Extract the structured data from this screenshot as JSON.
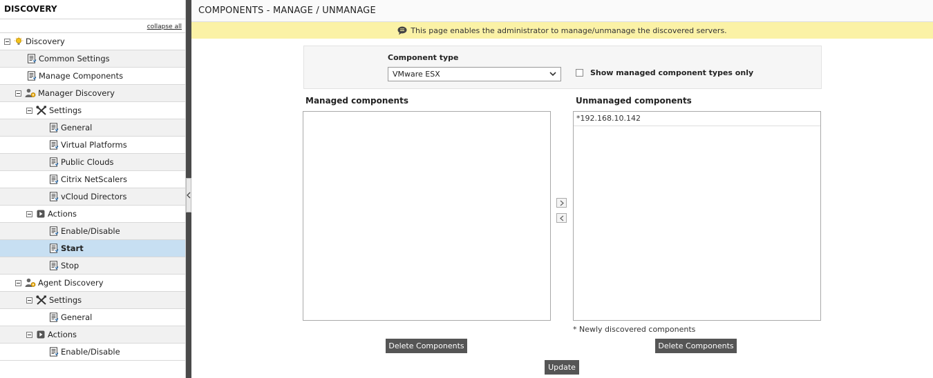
{
  "sidebar": {
    "title": "DISCOVERY",
    "collapse_all": "collapse all",
    "items": [
      {
        "label": "Discovery",
        "depth": 0,
        "toggle": true,
        "icon": "lightbulb-icon",
        "shade": false,
        "selected": false
      },
      {
        "label": "Common Settings",
        "depth": 1,
        "toggle": false,
        "icon": "page-icon",
        "shade": true,
        "selected": false
      },
      {
        "label": "Manage Components",
        "depth": 1,
        "toggle": false,
        "icon": "page-icon",
        "shade": false,
        "selected": false
      },
      {
        "label": "Manager Discovery",
        "depth": 1,
        "toggle": true,
        "icon": "user-gear-icon",
        "shade": true,
        "selected": false
      },
      {
        "label": "Settings",
        "depth": 2,
        "toggle": true,
        "icon": "tools-icon",
        "shade": false,
        "selected": false
      },
      {
        "label": "General",
        "depth": 3,
        "toggle": false,
        "icon": "page-icon",
        "shade": true,
        "selected": false
      },
      {
        "label": "Virtual Platforms",
        "depth": 3,
        "toggle": false,
        "icon": "page-icon",
        "shade": false,
        "selected": false
      },
      {
        "label": "Public Clouds",
        "depth": 3,
        "toggle": false,
        "icon": "page-icon",
        "shade": true,
        "selected": false
      },
      {
        "label": "Citrix NetScalers",
        "depth": 3,
        "toggle": false,
        "icon": "page-icon",
        "shade": false,
        "selected": false
      },
      {
        "label": "vCloud Directors",
        "depth": 3,
        "toggle": false,
        "icon": "page-icon",
        "shade": true,
        "selected": false
      },
      {
        "label": "Actions",
        "depth": 2,
        "toggle": true,
        "icon": "play-icon",
        "shade": false,
        "selected": false
      },
      {
        "label": "Enable/Disable",
        "depth": 3,
        "toggle": false,
        "icon": "page-icon",
        "shade": true,
        "selected": false
      },
      {
        "label": "Start",
        "depth": 3,
        "toggle": false,
        "icon": "page-icon",
        "shade": false,
        "selected": true
      },
      {
        "label": "Stop",
        "depth": 3,
        "toggle": false,
        "icon": "page-icon",
        "shade": true,
        "selected": false
      },
      {
        "label": "Agent Discovery",
        "depth": 1,
        "toggle": true,
        "icon": "user-gear-icon",
        "shade": false,
        "selected": false
      },
      {
        "label": "Settings",
        "depth": 2,
        "toggle": true,
        "icon": "tools-icon",
        "shade": true,
        "selected": false
      },
      {
        "label": "General",
        "depth": 3,
        "toggle": false,
        "icon": "page-icon",
        "shade": false,
        "selected": false
      },
      {
        "label": "Actions",
        "depth": 2,
        "toggle": true,
        "icon": "play-icon",
        "shade": true,
        "selected": false
      },
      {
        "label": "Enable/Disable",
        "depth": 3,
        "toggle": false,
        "icon": "page-icon",
        "shade": false,
        "selected": false
      }
    ]
  },
  "main": {
    "title": "COMPONENTS - MANAGE / UNMANAGE",
    "info": "This page enables the administrator to manage/unmanage the discovered servers.",
    "component_type_label": "Component type",
    "component_type_value": "VMware ESX",
    "show_managed_label": "Show managed component types only",
    "show_managed_checked": false,
    "managed_title": "Managed components",
    "managed_items": [],
    "unmanaged_title": "Unmanaged components",
    "unmanaged_items": [
      "*192.168.10.142"
    ],
    "footnote": "* Newly discovered components",
    "delete_managed_label": "Delete Components",
    "delete_unmanaged_label": "Delete Components",
    "update_label": "Update"
  },
  "colors": {
    "info_bg": "#fbf2a6",
    "selected_row": "#c7dff2",
    "dark_button": "#555555",
    "splitter": "#4a4a4a"
  }
}
